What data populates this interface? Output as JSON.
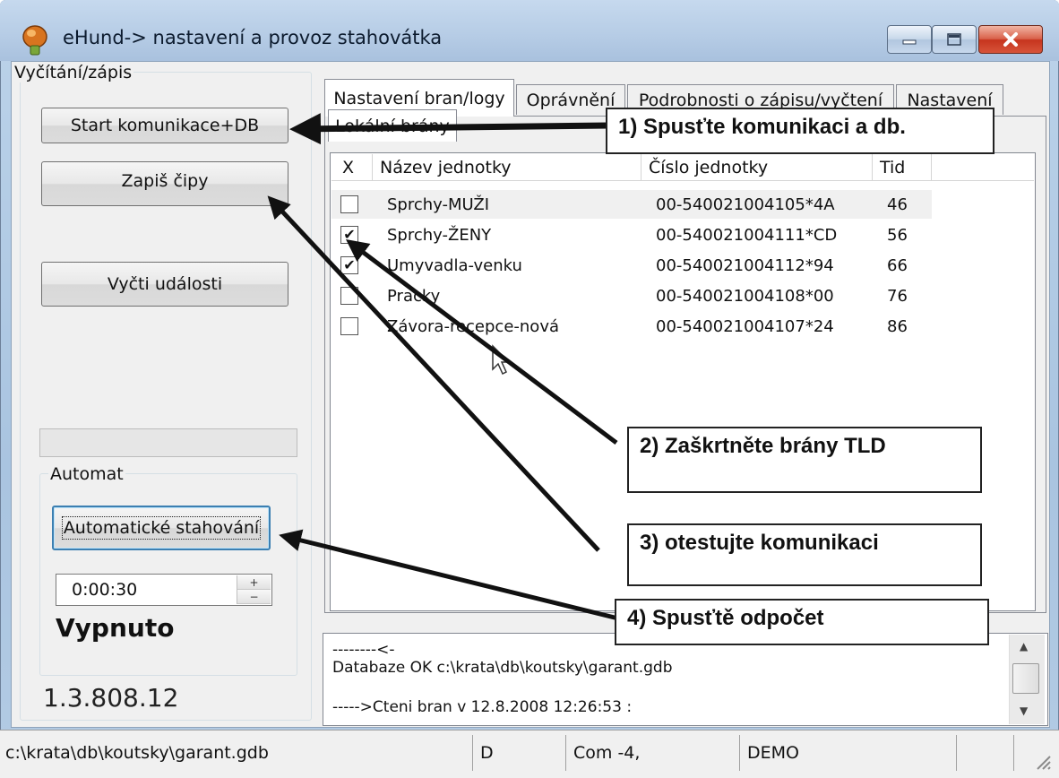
{
  "window": {
    "title": "eHund->  nastavení a provoz stahovátka"
  },
  "left_panel": {
    "group_label": "Vyčítání/zápis",
    "start_button": "Start komunikace+DB",
    "write_chips_button": "Zapiš čipy",
    "read_events_button": "Vyčti události",
    "progress_value": 0,
    "auto_group_label": "Automat",
    "auto_download_button": "Automatické stahování",
    "interval_value": "0:00:30",
    "state_text": "Vypnuto",
    "version": "1.3.808.12"
  },
  "tabs": [
    {
      "label": "Nastavení bran/logy",
      "active": true
    },
    {
      "label": "Oprávnění",
      "active": false
    },
    {
      "label": "Podrobnosti o zápisu/vyčtení",
      "active": false
    },
    {
      "label": "Nastavení",
      "active": false
    }
  ],
  "local_gates_tab": "Lokální brány",
  "gates_table": {
    "columns": [
      "X",
      "Název jednotky",
      "Číslo jednotky",
      "Tid"
    ],
    "rows": [
      {
        "checked": false,
        "name": "Sprchy-MUŽI",
        "number": "00-540021004105*4A",
        "tid": "46"
      },
      {
        "checked": true,
        "name": "Sprchy-ŽENY",
        "number": "00-540021004111*CD",
        "tid": "56"
      },
      {
        "checked": true,
        "name": "Umyvadla-venku",
        "number": "00-540021004112*94",
        "tid": "66"
      },
      {
        "checked": false,
        "name": "Pracky",
        "number": "00-540021004108*00",
        "tid": "76"
      },
      {
        "checked": false,
        "name": "Závora-recepce-nová",
        "number": "00-540021004107*24",
        "tid": "86"
      }
    ]
  },
  "log": {
    "lines": [
      "--------<-",
      "Databaze OK c:\\krata\\db\\koutsky\\garant.gdb",
      "",
      "----->Cteni bran v 12.8.2008 12:26:53 :"
    ]
  },
  "statusbar": {
    "path": "c:\\krata\\db\\koutsky\\garant.gdb",
    "drive": "D",
    "com": "Com -4,",
    "mode": "DEMO",
    "extra": ""
  },
  "callouts": [
    "1) Spusťte komunikaci a db.",
    "2) Zaškrtněte brány TLD",
    "3) otestujte komunikaci",
    "4) Spusťtě odpočet"
  ],
  "colors": {
    "title_gradient": "#b7cde6",
    "close_button": "#c6341d",
    "client_bg": "#f0f0f0",
    "focus_border": "#3c7fb1"
  }
}
